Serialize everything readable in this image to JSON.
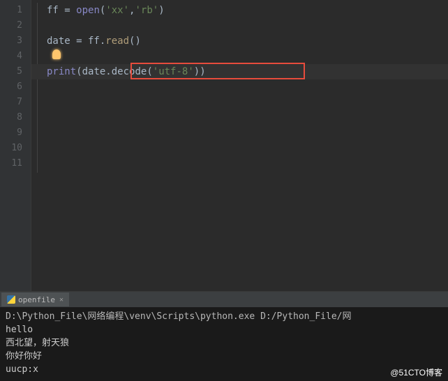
{
  "editor": {
    "lineNumbers": [
      "1",
      "2",
      "3",
      "4",
      "5",
      "6",
      "7",
      "8",
      "9",
      "10",
      "11"
    ],
    "code": {
      "line1": {
        "var": "ff",
        "op": " = ",
        "builtin": "open",
        "paren1": "(",
        "str1": "'xx'",
        "comma": ",",
        "str2": "'rb'",
        "paren2": ")"
      },
      "line3": {
        "var": "date",
        "op": " = ff.",
        "method": "read",
        "parens": "()"
      },
      "line5": {
        "builtin": "print",
        "paren1": "(",
        "var": "date.",
        "method": "decode",
        "paren2": "(",
        "str": "'utf-8'",
        "paren3": "))"
      }
    }
  },
  "terminal": {
    "tab": "openfile",
    "output": {
      "path": "D:\\Python_File\\网络编程\\venv\\Scripts\\python.exe D:/Python_File/网",
      "line2": "hello",
      "line3": "西北望，射天狼",
      "line4": "你好你好",
      "line5": "uucp:x"
    }
  },
  "watermark": "@51CTO博客"
}
